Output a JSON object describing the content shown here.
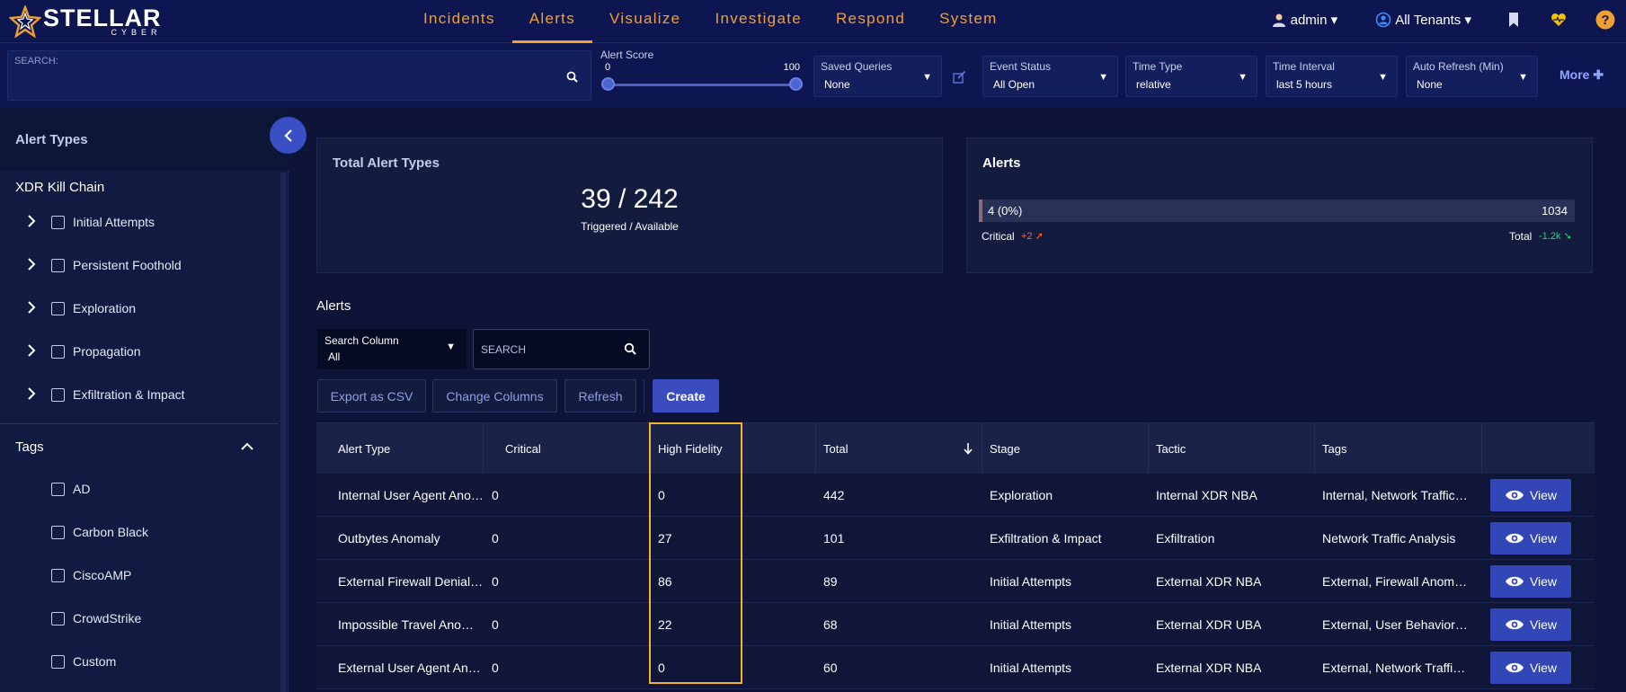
{
  "brand": {
    "name": "STELLAR",
    "sub": "CYBER"
  },
  "nav": {
    "items": [
      "Incidents",
      "Alerts",
      "Visualize",
      "Investigate",
      "Respond",
      "System"
    ],
    "active": "Alerts"
  },
  "header_right": {
    "user": "admin ▾",
    "tenants": "All Tenants ▾",
    "icons": [
      "bookmark-icon",
      "health-heart-icon",
      "help-icon"
    ]
  },
  "filters": {
    "search_label": "SEARCH:",
    "alert_score": {
      "label": "Alert Score",
      "min": "0",
      "max": "100"
    },
    "saved_queries": {
      "label": "Saved Queries",
      "value": "None"
    },
    "event_status": {
      "label": "Event Status",
      "value": "All Open"
    },
    "time_type": {
      "label": "Time Type",
      "value": "relative"
    },
    "time_interval": {
      "label": "Time Interval",
      "value": "last 5 hours"
    },
    "auto_refresh": {
      "label": "Auto Refresh (Min)",
      "value": "None"
    },
    "more": "More"
  },
  "sidebar": {
    "title": "Alert Types",
    "kill_chain_title": "XDR Kill Chain",
    "kill_chain": [
      "Initial Attempts",
      "Persistent Foothold",
      "Exploration",
      "Propagation",
      "Exfiltration & Impact"
    ],
    "tags_title": "Tags",
    "tags": [
      "AD",
      "Carbon Black",
      "CiscoAMP",
      "CrowdStrike",
      "Custom"
    ]
  },
  "cards": {
    "total": {
      "title": "Total Alert Types",
      "value": "39 / 242",
      "sub": "Triggered / Available"
    },
    "alerts": {
      "title": "Alerts",
      "critical_value": "4 (0%)",
      "total_value": "1034",
      "critical_label": "Critical",
      "critical_delta": "+2",
      "total_label": "Total",
      "total_delta": "-1.2k"
    }
  },
  "alerts_section": {
    "title": "Alerts",
    "search_column": {
      "label": "Search Column",
      "value": "All"
    },
    "search_placeholder": "SEARCH",
    "buttons": {
      "export": "Export as CSV",
      "columns": "Change Columns",
      "refresh": "Refresh",
      "create": "Create"
    }
  },
  "table": {
    "columns": [
      "Alert Type",
      "Critical",
      "High Fidelity",
      "Total",
      "Stage",
      "Tactic",
      "Tags"
    ],
    "view_label": "View",
    "rows": [
      {
        "type": "Internal User Agent Anomaly",
        "critical": "0",
        "high_fidelity": "0",
        "total": "442",
        "stage": "Exploration",
        "tactic": "Internal XDR NBA",
        "tags": "Internal, Network Traffic Analysis"
      },
      {
        "type": "Outbytes Anomaly",
        "critical": "0",
        "high_fidelity": "27",
        "total": "101",
        "stage": "Exfiltration & Impact",
        "tactic": "Exfiltration",
        "tags": "Network Traffic Analysis"
      },
      {
        "type": "External Firewall Denial Anomaly",
        "critical": "0",
        "high_fidelity": "86",
        "total": "89",
        "stage": "Initial Attempts",
        "tactic": "External XDR NBA",
        "tags": "External, Firewall Anomalies"
      },
      {
        "type": "Impossible Travel Anomaly",
        "critical": "0",
        "high_fidelity": "22",
        "total": "68",
        "stage": "Initial Attempts",
        "tactic": "External XDR UBA",
        "tags": "External, User Behavior Analytics"
      },
      {
        "type": "External User Agent Anomaly",
        "critical": "0",
        "high_fidelity": "0",
        "total": "60",
        "stage": "Initial Attempts",
        "tactic": "External XDR NBA",
        "tags": "External, Network Traffic Analysis"
      }
    ]
  },
  "colors": {
    "accent": "#f0a030",
    "primary": "#3a4cc0",
    "highlight": "#f5b32c"
  }
}
